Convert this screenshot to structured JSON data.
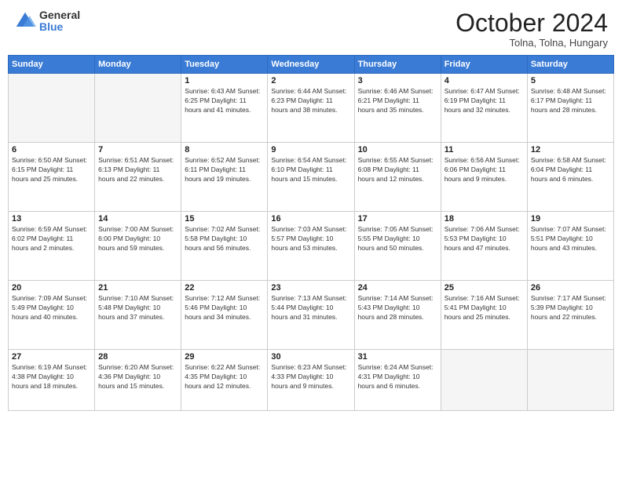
{
  "header": {
    "logo_general": "General",
    "logo_blue": "Blue",
    "title": "October 2024",
    "subtitle": "Tolna, Tolna, Hungary"
  },
  "days_of_week": [
    "Sunday",
    "Monday",
    "Tuesday",
    "Wednesday",
    "Thursday",
    "Friday",
    "Saturday"
  ],
  "weeks": [
    [
      {
        "day": "",
        "info": ""
      },
      {
        "day": "",
        "info": ""
      },
      {
        "day": "1",
        "info": "Sunrise: 6:43 AM\nSunset: 6:25 PM\nDaylight: 11 hours and 41 minutes."
      },
      {
        "day": "2",
        "info": "Sunrise: 6:44 AM\nSunset: 6:23 PM\nDaylight: 11 hours and 38 minutes."
      },
      {
        "day": "3",
        "info": "Sunrise: 6:46 AM\nSunset: 6:21 PM\nDaylight: 11 hours and 35 minutes."
      },
      {
        "day": "4",
        "info": "Sunrise: 6:47 AM\nSunset: 6:19 PM\nDaylight: 11 hours and 32 minutes."
      },
      {
        "day": "5",
        "info": "Sunrise: 6:48 AM\nSunset: 6:17 PM\nDaylight: 11 hours and 28 minutes."
      }
    ],
    [
      {
        "day": "6",
        "info": "Sunrise: 6:50 AM\nSunset: 6:15 PM\nDaylight: 11 hours and 25 minutes."
      },
      {
        "day": "7",
        "info": "Sunrise: 6:51 AM\nSunset: 6:13 PM\nDaylight: 11 hours and 22 minutes."
      },
      {
        "day": "8",
        "info": "Sunrise: 6:52 AM\nSunset: 6:11 PM\nDaylight: 11 hours and 19 minutes."
      },
      {
        "day": "9",
        "info": "Sunrise: 6:54 AM\nSunset: 6:10 PM\nDaylight: 11 hours and 15 minutes."
      },
      {
        "day": "10",
        "info": "Sunrise: 6:55 AM\nSunset: 6:08 PM\nDaylight: 11 hours and 12 minutes."
      },
      {
        "day": "11",
        "info": "Sunrise: 6:56 AM\nSunset: 6:06 PM\nDaylight: 11 hours and 9 minutes."
      },
      {
        "day": "12",
        "info": "Sunrise: 6:58 AM\nSunset: 6:04 PM\nDaylight: 11 hours and 6 minutes."
      }
    ],
    [
      {
        "day": "13",
        "info": "Sunrise: 6:59 AM\nSunset: 6:02 PM\nDaylight: 11 hours and 2 minutes."
      },
      {
        "day": "14",
        "info": "Sunrise: 7:00 AM\nSunset: 6:00 PM\nDaylight: 10 hours and 59 minutes."
      },
      {
        "day": "15",
        "info": "Sunrise: 7:02 AM\nSunset: 5:58 PM\nDaylight: 10 hours and 56 minutes."
      },
      {
        "day": "16",
        "info": "Sunrise: 7:03 AM\nSunset: 5:57 PM\nDaylight: 10 hours and 53 minutes."
      },
      {
        "day": "17",
        "info": "Sunrise: 7:05 AM\nSunset: 5:55 PM\nDaylight: 10 hours and 50 minutes."
      },
      {
        "day": "18",
        "info": "Sunrise: 7:06 AM\nSunset: 5:53 PM\nDaylight: 10 hours and 47 minutes."
      },
      {
        "day": "19",
        "info": "Sunrise: 7:07 AM\nSunset: 5:51 PM\nDaylight: 10 hours and 43 minutes."
      }
    ],
    [
      {
        "day": "20",
        "info": "Sunrise: 7:09 AM\nSunset: 5:49 PM\nDaylight: 10 hours and 40 minutes."
      },
      {
        "day": "21",
        "info": "Sunrise: 7:10 AM\nSunset: 5:48 PM\nDaylight: 10 hours and 37 minutes."
      },
      {
        "day": "22",
        "info": "Sunrise: 7:12 AM\nSunset: 5:46 PM\nDaylight: 10 hours and 34 minutes."
      },
      {
        "day": "23",
        "info": "Sunrise: 7:13 AM\nSunset: 5:44 PM\nDaylight: 10 hours and 31 minutes."
      },
      {
        "day": "24",
        "info": "Sunrise: 7:14 AM\nSunset: 5:43 PM\nDaylight: 10 hours and 28 minutes."
      },
      {
        "day": "25",
        "info": "Sunrise: 7:16 AM\nSunset: 5:41 PM\nDaylight: 10 hours and 25 minutes."
      },
      {
        "day": "26",
        "info": "Sunrise: 7:17 AM\nSunset: 5:39 PM\nDaylight: 10 hours and 22 minutes."
      }
    ],
    [
      {
        "day": "27",
        "info": "Sunrise: 6:19 AM\nSunset: 4:38 PM\nDaylight: 10 hours and 18 minutes."
      },
      {
        "day": "28",
        "info": "Sunrise: 6:20 AM\nSunset: 4:36 PM\nDaylight: 10 hours and 15 minutes."
      },
      {
        "day": "29",
        "info": "Sunrise: 6:22 AM\nSunset: 4:35 PM\nDaylight: 10 hours and 12 minutes."
      },
      {
        "day": "30",
        "info": "Sunrise: 6:23 AM\nSunset: 4:33 PM\nDaylight: 10 hours and 9 minutes."
      },
      {
        "day": "31",
        "info": "Sunrise: 6:24 AM\nSunset: 4:31 PM\nDaylight: 10 hours and 6 minutes."
      },
      {
        "day": "",
        "info": ""
      },
      {
        "day": "",
        "info": ""
      }
    ]
  ]
}
